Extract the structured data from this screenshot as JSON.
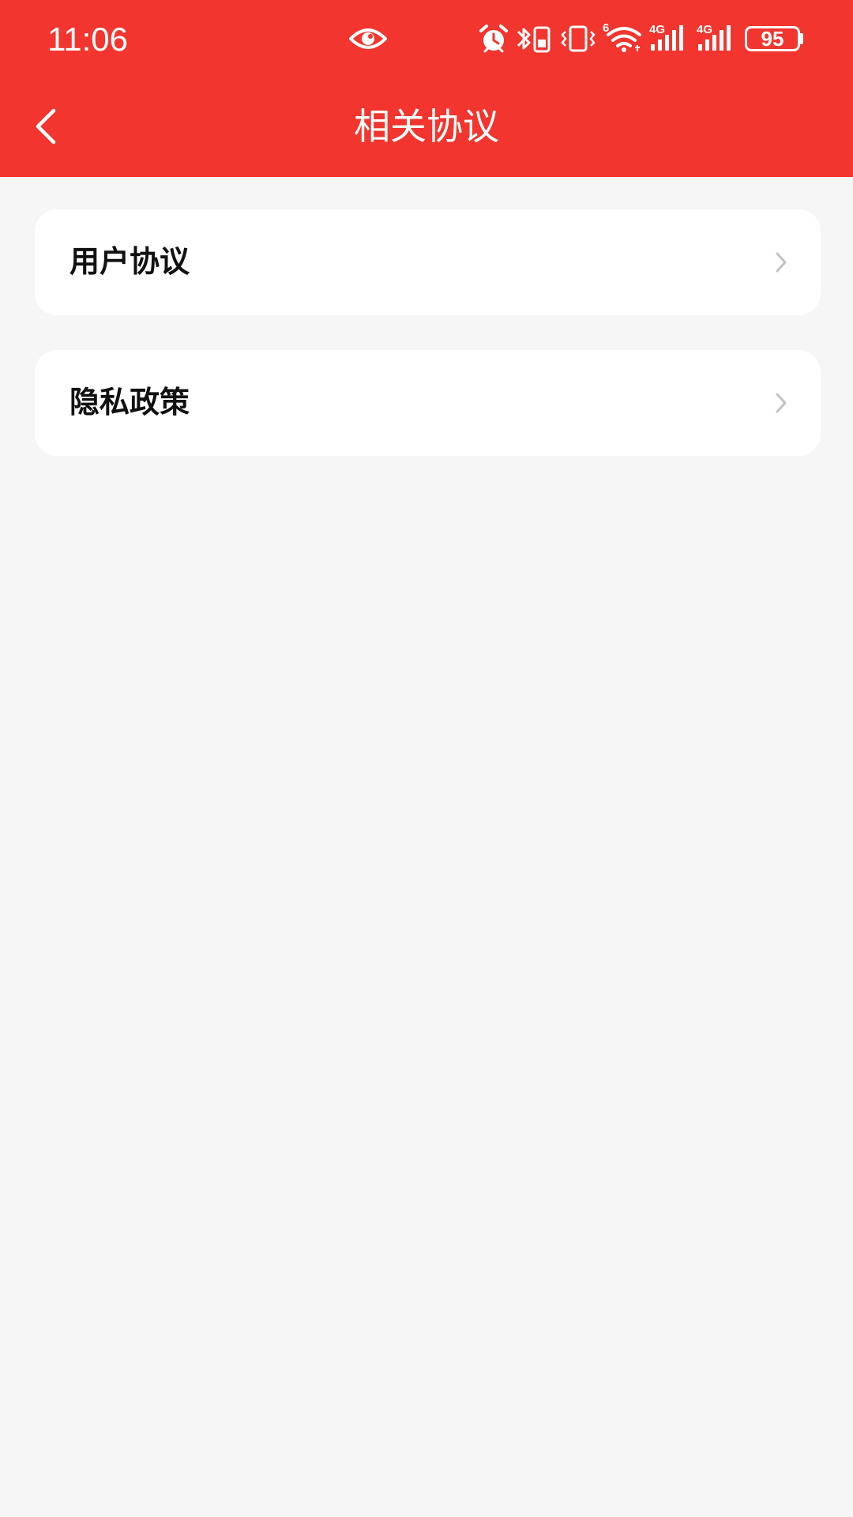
{
  "status_bar": {
    "time": "11:06",
    "battery_level": "95",
    "signal_1_label": "4G",
    "signal_2_label": "4G",
    "wifi_label": "6",
    "icons": [
      "eye-icon",
      "alarm-icon",
      "bluetooth-icon",
      "vibrate-icon",
      "wifi-icon",
      "signal-icon",
      "signal-icon",
      "battery-icon"
    ]
  },
  "nav": {
    "title": "相关协议",
    "back_icon": "chevron-left-icon"
  },
  "list": {
    "items": [
      {
        "label": "用户协议",
        "icon": "chevron-right-icon"
      },
      {
        "label": "隐私政策",
        "icon": "chevron-right-icon"
      }
    ]
  },
  "colors": {
    "header": "#f2352e",
    "background": "#f6f6f6",
    "card": "#ffffff",
    "chevron": "#c2c2c2"
  }
}
